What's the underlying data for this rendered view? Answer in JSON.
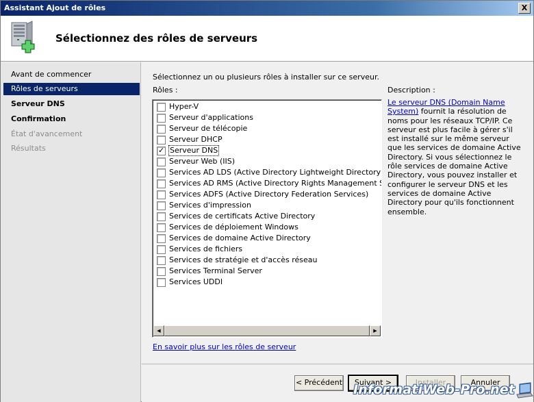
{
  "window": {
    "title": "Assistant Ajout de rôles",
    "close_label": "X"
  },
  "header": {
    "title": "Sélectionnez des rôles de serveurs",
    "icon": "server-add-icon"
  },
  "nav": {
    "items": [
      {
        "label": "Avant de commencer",
        "state": "normal"
      },
      {
        "label": "Rôles de serveurs",
        "state": "active"
      },
      {
        "label": "Serveur DNS",
        "state": "bold"
      },
      {
        "label": "Confirmation",
        "state": "bold"
      },
      {
        "label": "État d'avancement",
        "state": "disabled"
      },
      {
        "label": "Résultats",
        "state": "disabled"
      }
    ]
  },
  "main": {
    "intro": "Sélectionnez un ou plusieurs rôles à installer sur ce serveur.",
    "roles_label": "Rôles :",
    "roles": [
      {
        "label": "Hyper-V",
        "checked": false
      },
      {
        "label": "Serveur d'applications",
        "checked": false
      },
      {
        "label": "Serveur de télécopie",
        "checked": false
      },
      {
        "label": "Serveur DHCP",
        "checked": false
      },
      {
        "label": "Serveur DNS",
        "checked": true
      },
      {
        "label": "Serveur Web (IIS)",
        "checked": false
      },
      {
        "label": "Services AD LDS (Active Directory Lightweight Directory Services)",
        "checked": false
      },
      {
        "label": "Services AD RMS (Active Directory Rights Management Services)",
        "checked": false
      },
      {
        "label": "Services ADFS (Active Directory Federation Services)",
        "checked": false
      },
      {
        "label": "Services d'impression",
        "checked": false
      },
      {
        "label": "Services de certificats Active Directory",
        "checked": false
      },
      {
        "label": "Services de déploiement Windows",
        "checked": false
      },
      {
        "label": "Services de domaine Active Directory",
        "checked": false
      },
      {
        "label": "Services de fichiers",
        "checked": false
      },
      {
        "label": "Services de stratégie et d'accès réseau",
        "checked": false
      },
      {
        "label": "Services Terminal Server",
        "checked": false
      },
      {
        "label": "Services UDDI",
        "checked": false
      }
    ],
    "selected_role": "Serveur DNS",
    "check_mark": "✓",
    "scroll_left": "◀",
    "scroll_right": "▶",
    "learn_more_link": "En savoir plus sur les rôles de serveur"
  },
  "description": {
    "label": "Description :",
    "link_text": "Le serveur DNS (Domain Name System)",
    "body": " fournit la résolution de noms pour les réseaux TCP/IP. Ce serveur est plus facile à gérer s'il est installé sur le même serveur que les services de domaine Active Directory. Si vous sélectionnez le rôle services de domaine Active Directory, vous pouvez installer et configurer le serveur DNS et les services de domaine Active Directory pour qu'ils fonctionnent ensemble."
  },
  "buttons": {
    "previous": "< Précédent",
    "next": "Suivant >",
    "install": "Installer",
    "cancel": "Annuler"
  },
  "watermark": "InformatiWeb-Pro.net",
  "colors": {
    "title_gradient_start": "#0a246a",
    "nav_active": "#0a246a",
    "link": "#0000cc"
  }
}
